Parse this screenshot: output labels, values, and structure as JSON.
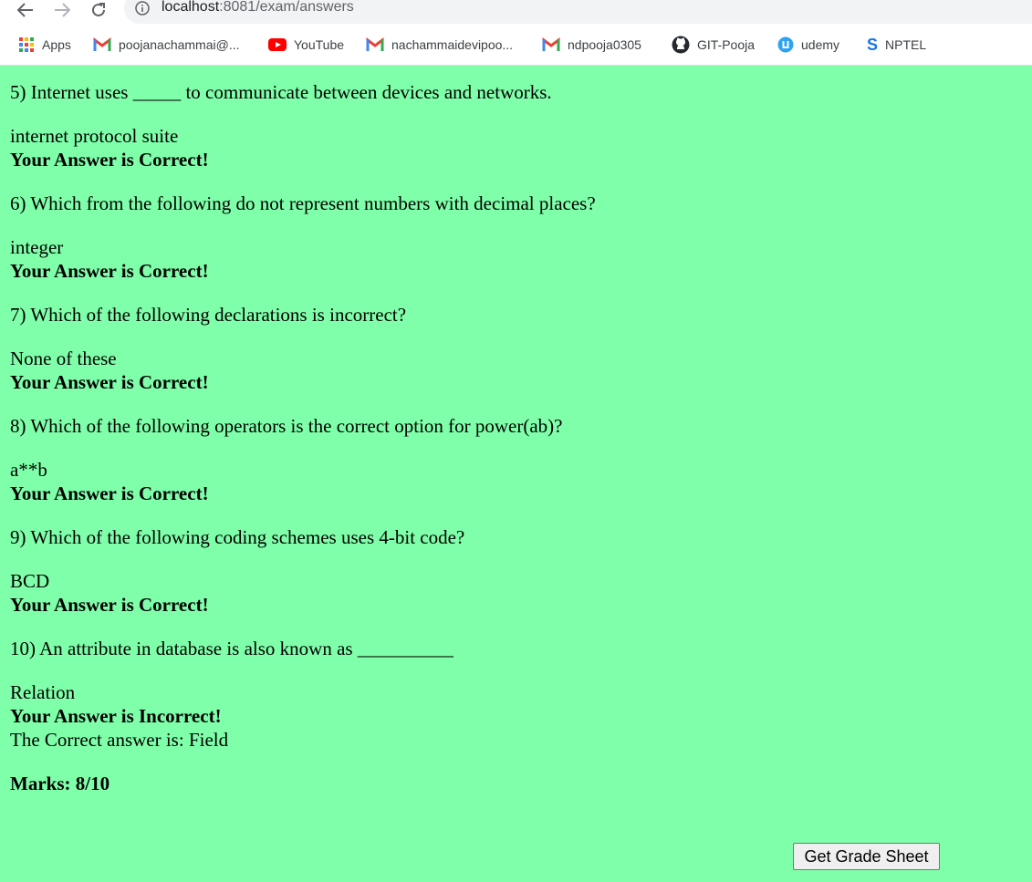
{
  "browser": {
    "url_host": "localhost",
    "url_rest": ":8081/exam/answers",
    "bookmarks": [
      {
        "label": "Apps",
        "icon": "apps-grid-icon"
      },
      {
        "label": "poojanachammai@...",
        "icon": "gmail-icon"
      },
      {
        "label": "YouTube",
        "icon": "youtube-icon"
      },
      {
        "label": "nachammaidevipoo...",
        "icon": "gmail-icon"
      },
      {
        "label": "ndpooja0305",
        "icon": "gmail-icon"
      },
      {
        "label": "GIT-Pooja",
        "icon": "github-icon"
      },
      {
        "label": "udemy",
        "icon": "udemy-icon"
      },
      {
        "label": "NPTEL",
        "icon": "nptel-icon"
      }
    ]
  },
  "colors": {
    "page_background": "#80ffaa"
  },
  "questions": [
    {
      "question": "5) Internet uses _____ to communicate between devices and networks.",
      "answer": "internet protocol suite",
      "result": "Your Answer is Correct!"
    },
    {
      "question": "6) Which from the following do not represent numbers with decimal places?",
      "answer": "integer",
      "result": "Your Answer is Correct!"
    },
    {
      "question": "7) Which of the following declarations is incorrect?",
      "answer": "None of these",
      "result": "Your Answer is Correct!"
    },
    {
      "question": "8) Which of the following operators is the correct option for power(ab)?",
      "answer": "a**b",
      "result": "Your Answer is Correct!"
    },
    {
      "question": "9) Which of the following coding schemes uses 4-bit code?",
      "answer": "BCD",
      "result": "Your Answer is Correct!"
    },
    {
      "question": "10) An attribute in database is also known as __________",
      "answer": "Relation",
      "result": "Your Answer is Incorrect!",
      "correct_answer": "The Correct answer is: Field"
    }
  ],
  "marks": "Marks: 8/10",
  "grade_button_label": "Get Grade Sheet"
}
